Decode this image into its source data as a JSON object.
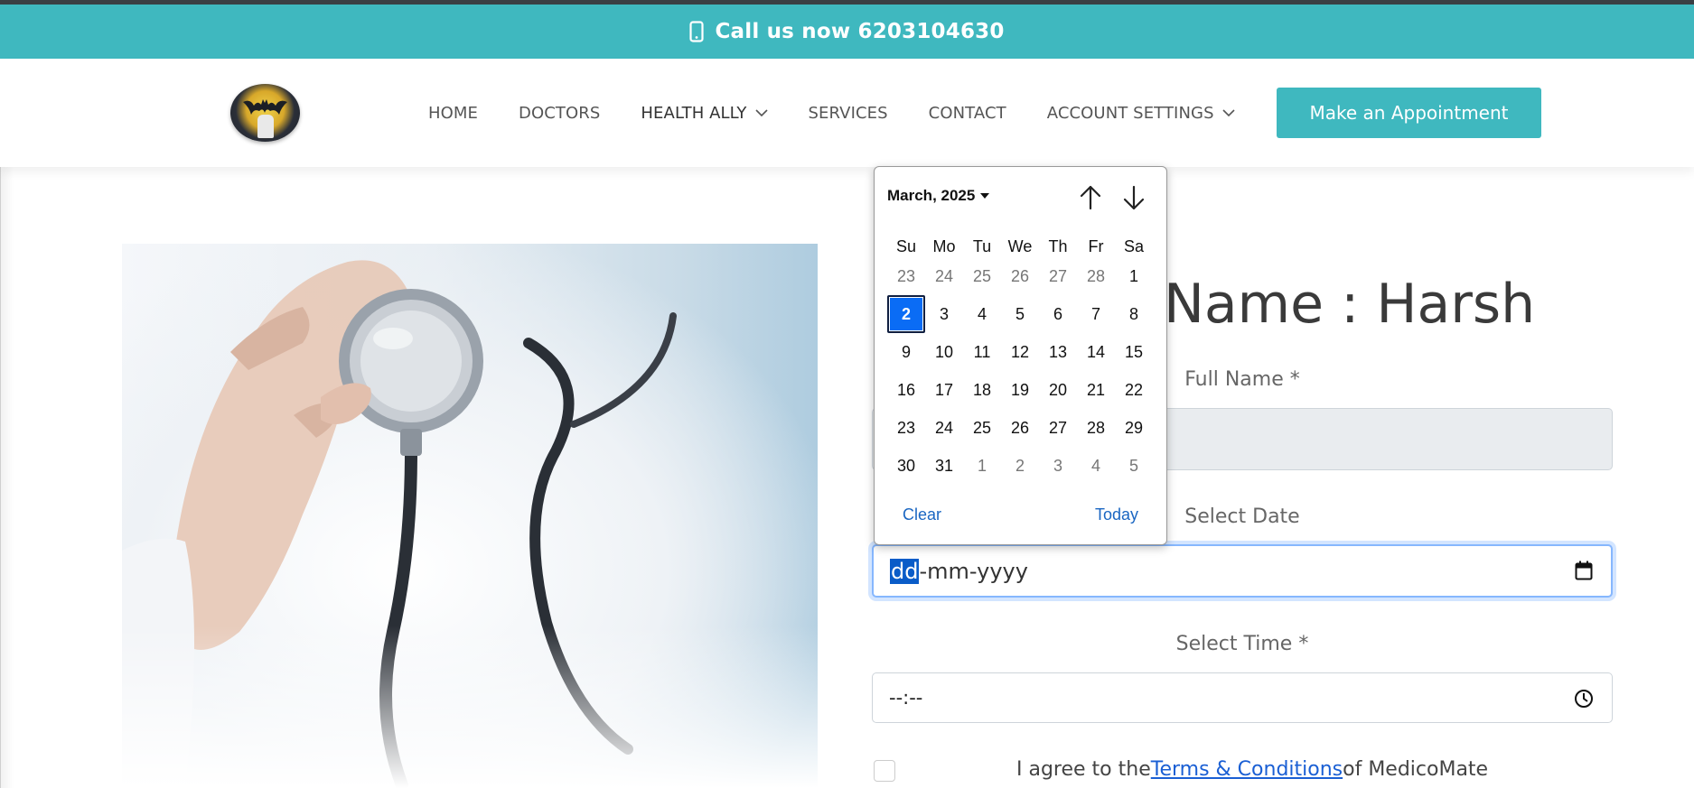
{
  "topbar": {
    "call_text": "Call us now 6203104630",
    "icon": "mobile-phone-icon"
  },
  "nav": {
    "logo": "batman-logo",
    "items": [
      {
        "label": "HOME"
      },
      {
        "label": "DOCTORS"
      },
      {
        "label": "HEALTH ALLY",
        "dropdown": true
      },
      {
        "label": "SERVICES"
      },
      {
        "label": "CONTACT"
      },
      {
        "label": "ACCOUNT SETTINGS",
        "dropdown": true
      }
    ],
    "cta_label": "Make an Appointment"
  },
  "form": {
    "title": "Name : Harsh",
    "full_name_label": "Full Name *",
    "full_name_value": "",
    "date_label": "Select Date",
    "date_placeholder_dd": "dd",
    "date_placeholder_rest": "-mm-yyyy",
    "time_label": "Select Time *",
    "time_value": "--:--",
    "agree_prefix": "I agree to the",
    "agree_link": "Terms & Conditions",
    "agree_suffix": "of MedicoMate"
  },
  "calendar": {
    "month_label": "March, 2025",
    "weekdays": [
      "Su",
      "Mo",
      "Tu",
      "We",
      "Th",
      "Fr",
      "Sa"
    ],
    "days": [
      {
        "d": "23",
        "muted": true
      },
      {
        "d": "24",
        "muted": true
      },
      {
        "d": "25",
        "muted": true
      },
      {
        "d": "26",
        "muted": true
      },
      {
        "d": "27",
        "muted": true
      },
      {
        "d": "28",
        "muted": true
      },
      {
        "d": "1"
      },
      {
        "d": "2",
        "selected": true
      },
      {
        "d": "3"
      },
      {
        "d": "4"
      },
      {
        "d": "5"
      },
      {
        "d": "6"
      },
      {
        "d": "7"
      },
      {
        "d": "8"
      },
      {
        "d": "9"
      },
      {
        "d": "10"
      },
      {
        "d": "11"
      },
      {
        "d": "12"
      },
      {
        "d": "13"
      },
      {
        "d": "14"
      },
      {
        "d": "15"
      },
      {
        "d": "16"
      },
      {
        "d": "17"
      },
      {
        "d": "18"
      },
      {
        "d": "19"
      },
      {
        "d": "20"
      },
      {
        "d": "21"
      },
      {
        "d": "22"
      },
      {
        "d": "23"
      },
      {
        "d": "24"
      },
      {
        "d": "25"
      },
      {
        "d": "26"
      },
      {
        "d": "27"
      },
      {
        "d": "28"
      },
      {
        "d": "29"
      },
      {
        "d": "30"
      },
      {
        "d": "31"
      },
      {
        "d": "1",
        "muted": true
      },
      {
        "d": "2",
        "muted": true
      },
      {
        "d": "3",
        "muted": true
      },
      {
        "d": "4",
        "muted": true
      },
      {
        "d": "5",
        "muted": true
      }
    ],
    "clear_label": "Clear",
    "today_label": "Today"
  },
  "colors": {
    "brand": "#3fb8bf",
    "selected_day": "#0a6cf5",
    "link": "#1a5fd4"
  }
}
